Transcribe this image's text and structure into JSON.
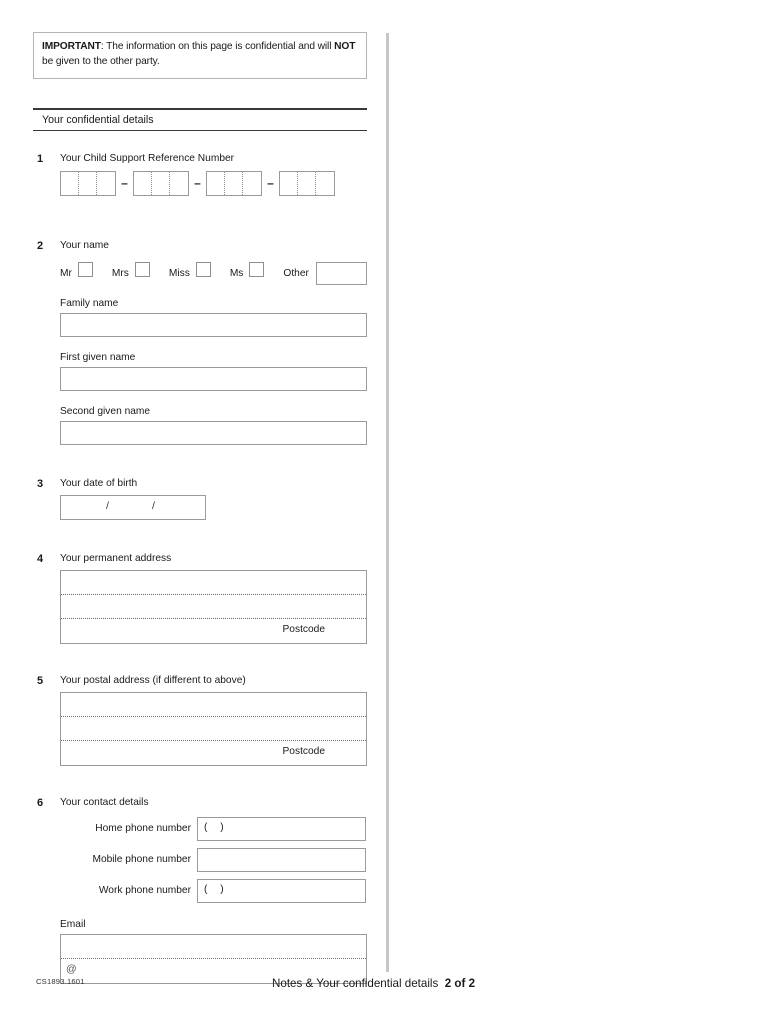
{
  "notice": {
    "bold_lead": "IMPORTANT",
    "text_part1": ": The information on this page is confidential and will ",
    "bold_second": "NOT",
    "text_part2": " be given to the other party."
  },
  "section": {
    "heading": "Your confidential details"
  },
  "questions": [
    {
      "number": "1",
      "label": "Your Child Support Reference Number",
      "type": "reference-number",
      "groups": 4,
      "cells_per_group": 3,
      "separator": "–"
    },
    {
      "number": "2",
      "label": "Your name",
      "type": "name",
      "titles": [
        "Mr",
        "Mrs",
        "Miss",
        "Ms"
      ],
      "other_label": "Other",
      "fields": [
        {
          "label": "Family name",
          "value": ""
        },
        {
          "label": "First given name",
          "value": ""
        },
        {
          "label": "Second given name",
          "value": ""
        }
      ]
    },
    {
      "number": "3",
      "label": "Your date of birth",
      "type": "date",
      "separator": "/"
    },
    {
      "number": "4",
      "label": "Your permanent address",
      "type": "address",
      "postcode_label": "Postcode"
    },
    {
      "number": "5",
      "label": "Your postal address (if different to above)",
      "type": "address",
      "postcode_label": "Postcode"
    },
    {
      "number": "6",
      "label": "Your contact details",
      "type": "contact",
      "rows": [
        {
          "label": "Home phone number",
          "prefix": "(      )"
        },
        {
          "label": "Mobile phone number",
          "prefix": ""
        },
        {
          "label": "Work phone number",
          "prefix": "(      )"
        }
      ],
      "email_label": "Email",
      "email_at": "@"
    }
  ],
  "footer": {
    "form_code": "CS1893.1601",
    "title": "Notes & Your confidential details",
    "page": "2 of 2"
  },
  "colors": {
    "divider": "#c6c6c6",
    "box_border": "#9a9a9a",
    "rule": "#3a3a3a"
  }
}
